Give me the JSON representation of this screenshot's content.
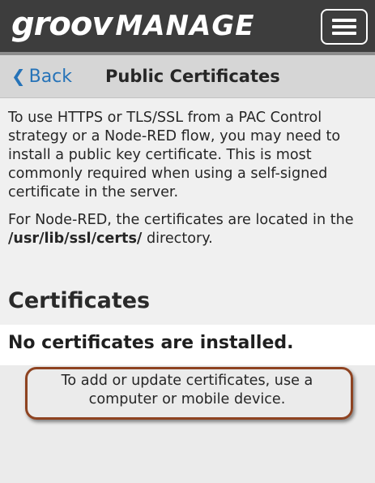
{
  "header": {
    "logo_groov": "groov",
    "logo_manage": "MANAGE",
    "menu_icon": "hamburger-menu-icon"
  },
  "nav": {
    "back_icon": "chevron-left-icon",
    "back_label": "Back",
    "title": "Public Certificates"
  },
  "intro": {
    "paragraph1": "To use HTTPS or TLS/SSL from a PAC Control strategy or a Node-RED flow, you may need to install a public key certificate. This is most commonly required when using a self-signed certificate in the server.",
    "paragraph2_before": "For Node-RED, the certificates are located in the ",
    "paragraph2_path": "/usr/lib/ssl/certs/",
    "paragraph2_after": " directory."
  },
  "certificates": {
    "heading": "Certificates",
    "empty_message": "No certificates are installed.",
    "notice": "To add or update certificates, use a computer or mobile device."
  },
  "colors": {
    "header_bg": "#3d3d3d",
    "nav_bg": "#d6d6d6",
    "link": "#2673b8",
    "highlight": "#8e4321"
  }
}
